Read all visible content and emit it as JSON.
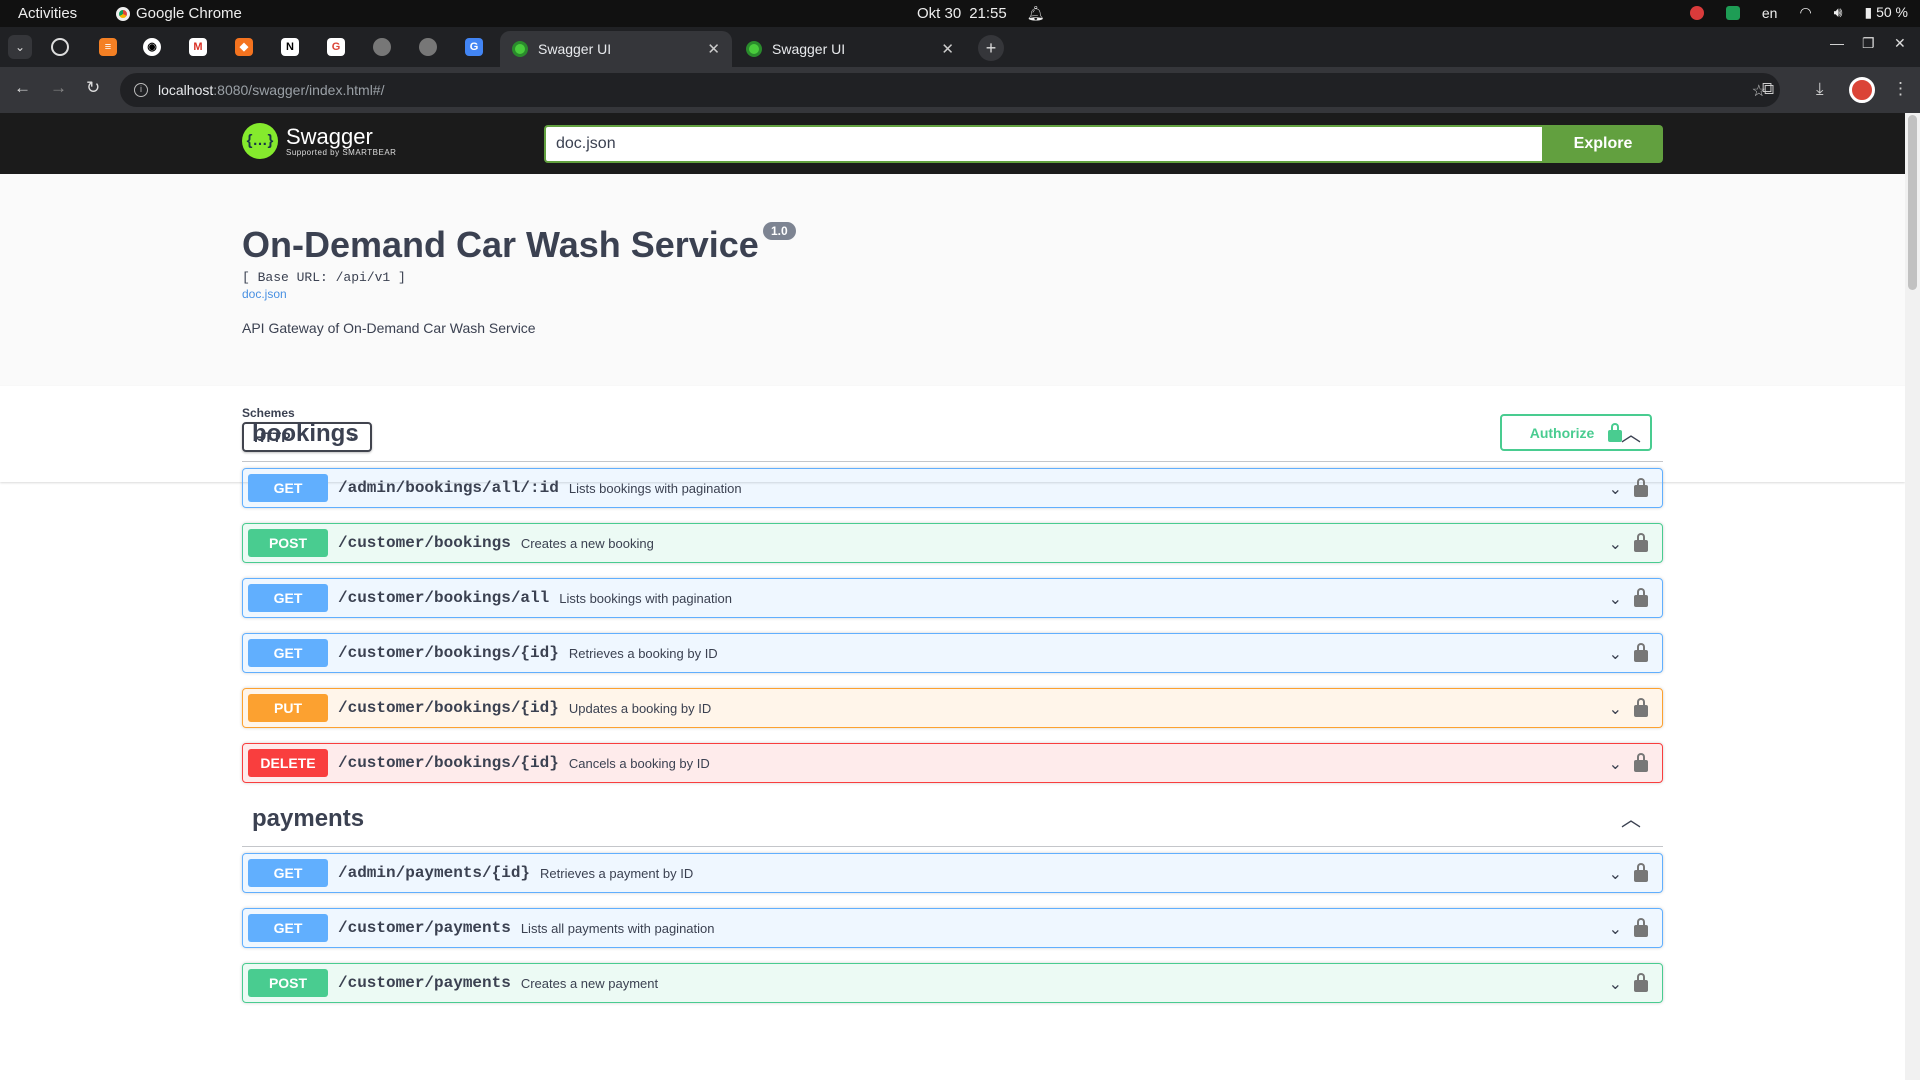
{
  "system_bar": {
    "activities": "Activities",
    "app_name": "Google Chrome",
    "date": "Okt 30",
    "time": "21:55",
    "language": "en",
    "battery": "50 %"
  },
  "browser": {
    "tabs": [
      {
        "title": "Swagger UI",
        "active": true
      },
      {
        "title": "Swagger UI",
        "active": false
      }
    ],
    "url_host": "localhost",
    "url_path": ":8080/swagger/index.html#/"
  },
  "swagger": {
    "logo_text": "Swagger",
    "logo_subtext": "Supported by SMARTBEAR",
    "search_value": "doc.json",
    "explore_label": "Explore",
    "title": "On-Demand Car Wash Service",
    "version": "1.0",
    "base_url": "[ Base URL: /api/v1 ]",
    "doc_link": "doc.json",
    "description": "API Gateway of On-Demand Car Wash Service",
    "schemes_label": "Schemes",
    "scheme_selected": "HTTP",
    "authorize_label": "Authorize"
  },
  "tags": [
    {
      "name": "bookings",
      "operations": [
        {
          "method": "GET",
          "path": "/admin/bookings/all/:id",
          "summary": "Lists bookings with pagination"
        },
        {
          "method": "POST",
          "path": "/customer/bookings",
          "summary": "Creates a new booking"
        },
        {
          "method": "GET",
          "path": "/customer/bookings/all",
          "summary": "Lists bookings with pagination"
        },
        {
          "method": "GET",
          "path": "/customer/bookings/{id}",
          "summary": "Retrieves a booking by ID"
        },
        {
          "method": "PUT",
          "path": "/customer/bookings/{id}",
          "summary": "Updates a booking by ID"
        },
        {
          "method": "DELETE",
          "path": "/customer/bookings/{id}",
          "summary": "Cancels a booking by ID"
        }
      ]
    },
    {
      "name": "payments",
      "operations": [
        {
          "method": "GET",
          "path": "/admin/payments/{id}",
          "summary": "Retrieves a payment by ID"
        },
        {
          "method": "GET",
          "path": "/customer/payments",
          "summary": "Lists all payments with pagination"
        },
        {
          "method": "POST",
          "path": "/customer/payments",
          "summary": "Creates a new payment"
        }
      ]
    }
  ],
  "colors": {
    "get": "#61affe",
    "post": "#49cc90",
    "put": "#fca130",
    "delete": "#f93e3e",
    "swagger_green": "#62a03f"
  }
}
